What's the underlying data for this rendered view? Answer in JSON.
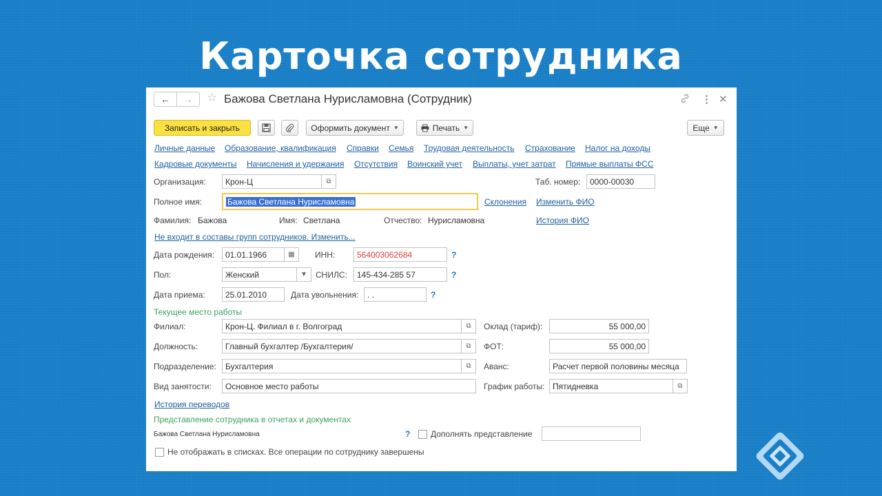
{
  "slide": {
    "title": "Карточка сотрудника"
  },
  "window": {
    "title": "Бажова Светлана Нурисламовна (Сотрудник)",
    "back_icon": "arrow-left-icon",
    "forward_icon": "arrow-right-icon",
    "favorite_icon": "star-icon",
    "link_icon": "link-icon",
    "more_icon": "more-vertical-icon",
    "close_icon": "close-icon"
  },
  "toolbar": {
    "save_close": "Записать и закрыть",
    "save_icon": "floppy-disk-icon",
    "attach_icon": "paperclip-icon",
    "create_doc": "Оформить документ",
    "print": "Печать",
    "more": "Еще"
  },
  "nav_links": {
    "row1": [
      "Личные данные",
      "Образование, квалификация",
      "Справки",
      "Семья",
      "Трудовая деятельность",
      "Страхование",
      "Налог на доходы"
    ],
    "row2": [
      "Кадровые документы",
      "Начисления и удержания",
      "Отсутствия",
      "Воинский учет",
      "Выплаты, учет затрат",
      "Прямые выплаты ФСС"
    ]
  },
  "form": {
    "org_label": "Организация:",
    "org_value": "Крон-Ц",
    "tab_label": "Таб. номер:",
    "tab_value": "0000-00030",
    "fullname_label": "Полное имя:",
    "fullname_value": "Бажова Светлана Нурисламовна",
    "declensions": "Склонения",
    "change_fio": "Изменить ФИО",
    "surname_label": "Фамилия:",
    "surname_value": "Бажова",
    "name_label": "Имя:",
    "name_value": "Светлана",
    "patronymic_label": "Отчество:",
    "patronymic_value": "Нурисламовна",
    "fio_history": "История ФИО",
    "groups_link": "Не входит в составы групп сотрудников. Изменить...",
    "birth_label": "Дата рождения:",
    "birth_value": "01.01.1966",
    "inn_label": "ИНН:",
    "inn_value": "564003062684",
    "gender_label": "Пол:",
    "gender_value": "Женский",
    "snils_label": "СНИЛС:",
    "snils_value": "145-434-285 57",
    "hire_label": "Дата приема:",
    "hire_value": "25.01.2010",
    "fire_label": "Дата увольнения:",
    "fire_value": " .  .",
    "help": "?"
  },
  "workplace": {
    "section_title": "Текущее место работы",
    "branch_label": "Филиал:",
    "branch_value": "Крон-Ц. Филиал в г. Волгоград",
    "position_label": "Должность:",
    "position_value": "Главный бухгалтер /Бухгалтерия/",
    "dept_label": "Подразделение:",
    "dept_value": "Бухгалтерия",
    "employment_label": "Вид занятости:",
    "employment_value": "Основное место работы",
    "salary_label": "Оклад (тариф):",
    "salary_value": "55 000,00",
    "fot_label": "ФОТ:",
    "fot_value": "55 000,00",
    "advance_label": "Аванс:",
    "advance_value": "Расчет первой половины месяца",
    "schedule_label": "График работы:",
    "schedule_value": "Пятидневка",
    "transfer_history": "История переводов"
  },
  "representation": {
    "section_title": "Представление сотрудника в отчетах и документах",
    "value": "Бажова Светлана Нурисламовна",
    "supplement_label": "Дополнять представление",
    "supplement_checked": false,
    "hide_label": "Не отображать в списках. Все операции по сотруднику завершены",
    "hide_checked": false
  },
  "colors": {
    "background": "#1a7fc7",
    "primary_button": "#fbe044",
    "link": "#1f5f9e",
    "section": "#3aa25c",
    "inn_text": "#e23b3b"
  }
}
